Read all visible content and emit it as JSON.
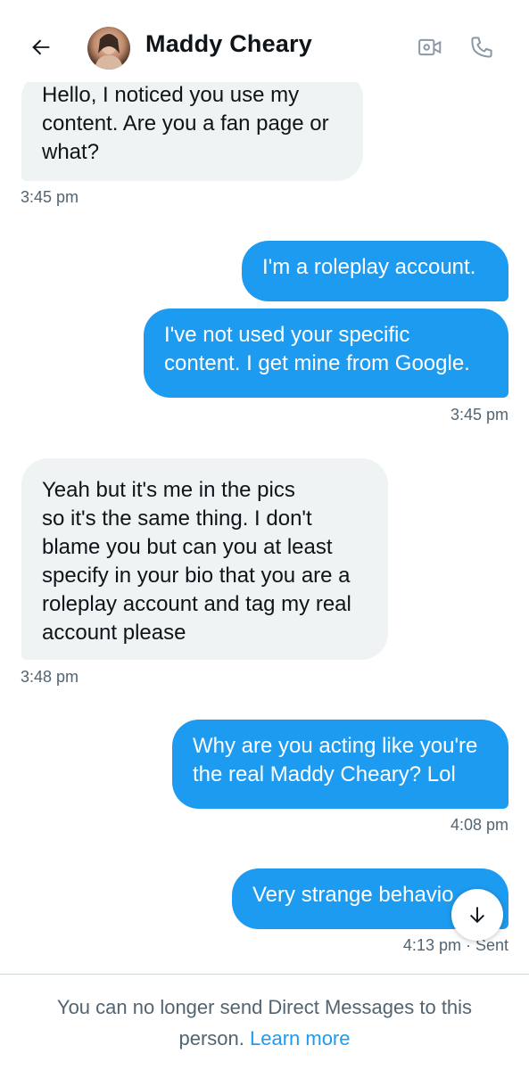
{
  "header": {
    "contact_name": "Maddy Cheary",
    "back_icon": "arrow-left-icon",
    "video_icon": "video-camera-icon",
    "phone_icon": "phone-icon"
  },
  "messages": [
    {
      "direction": "in",
      "text": "Hello, I noticed you use my content. Are you a fan page or what?",
      "lines": [
        "Hello, I noticed you use my",
        "content. Are you a fan page or",
        "what?"
      ],
      "time": "3:45 pm"
    },
    {
      "direction": "out",
      "text": "I'm a roleplay account.",
      "lines": [
        "I'm a roleplay account."
      ],
      "time": ""
    },
    {
      "direction": "out",
      "text": "I've not used your specific content. I get mine from Google.",
      "lines": [
        "I've not used your specific",
        "content. I get mine from Google."
      ],
      "time": "3:45 pm"
    },
    {
      "direction": "in",
      "text": "Yeah but it's me in the pics so it's the same thing. I don't blame you but can you at least specify in your bio that you are a roleplay account and tag my real account please",
      "lines": [
        "Yeah but it's me in the pics",
        "so it's the same thing. I don't",
        "blame you but can you at least",
        "specify in your bio that you are a",
        "roleplay account and tag my real",
        "account please"
      ],
      "time": "3:48 pm"
    },
    {
      "direction": "out",
      "text": "Why are you acting like you're the real Maddy Cheary? Lol",
      "lines": [
        "Why are you acting like you're",
        "the real Maddy Cheary? Lol"
      ],
      "time": "4:08 pm"
    },
    {
      "direction": "out",
      "text": "Very strange behavio",
      "lines": [
        "Very strange behavio"
      ],
      "time": "4:13 pm · Sent"
    }
  ],
  "scroll_button": {
    "icon": "arrow-down-icon"
  },
  "footer": {
    "notice": "You can no longer send Direct Messages to this person.",
    "line1": "You can no longer send Direct Messages to this",
    "line2_prefix": "person. ",
    "link": "Learn more"
  },
  "colors": {
    "accent": "#1d9bf0",
    "incoming_bubble": "#eff3f4",
    "muted_text": "#536471",
    "divider": "#cfd9de"
  }
}
